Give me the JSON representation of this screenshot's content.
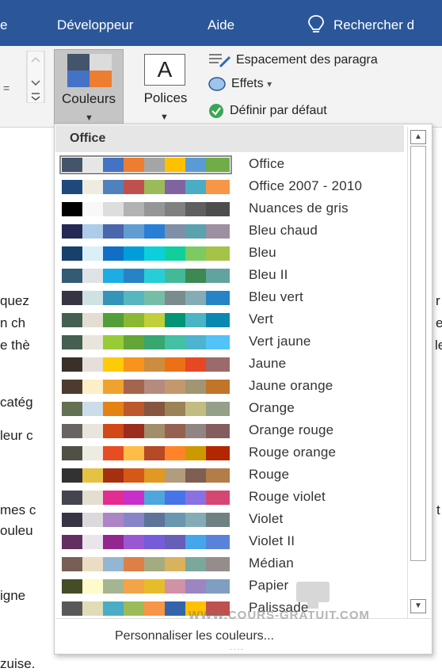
{
  "tabs": {
    "partial_left": "e",
    "developer": "Développeur",
    "help": "Aide",
    "tell_me": "Rechercher d"
  },
  "ribbon": {
    "colors_label": "Couleurs",
    "fonts_label": "Polices",
    "fonts_glyph": "A",
    "paragraph_spacing": "Espacement des paragra",
    "effects": "Effets",
    "effects_arrow": "▾",
    "set_default": "Définir par défaut",
    "spin_partial": "="
  },
  "document_fragments": [
    {
      "id": "f1",
      "text": "quez"
    },
    {
      "id": "f2",
      "text": "n ch"
    },
    {
      "id": "f3",
      "text": "e thè"
    },
    {
      "id": "f4",
      "text": "catég"
    },
    {
      "id": "f5",
      "text": "leur c"
    },
    {
      "id": "f6",
      "text": "mes c"
    },
    {
      "id": "f7",
      "text": "ouleu"
    },
    {
      "id": "f8",
      "text": "igne"
    },
    {
      "id": "f9",
      "text": "zuise."
    },
    {
      "id": "r1",
      "text": "r"
    },
    {
      "id": "r2",
      "text": "e"
    },
    {
      "id": "r3",
      "text": "le"
    },
    {
      "id": "r4",
      "text": "t"
    }
  ],
  "panel": {
    "header": "Office",
    "customize_label": "Personnaliser les couleurs...",
    "grip": "....",
    "watermark": "WWW.COURS-GRATUIT.COM"
  },
  "themes": [
    {
      "name": "Office",
      "selected": true,
      "colors": [
        "#44546a",
        "#e7e6e6",
        "#4472c4",
        "#ed7d31",
        "#a5a5a5",
        "#ffc000",
        "#5b9bd5",
        "#70ad47"
      ]
    },
    {
      "name": "Office 2007 - 2010",
      "colors": [
        "#1f497d",
        "#eeece1",
        "#4f81bd",
        "#c0504d",
        "#9bbb59",
        "#8064a2",
        "#4bacc6",
        "#f79646"
      ]
    },
    {
      "name": "Nuances de gris",
      "colors": [
        "#000000",
        "#f8f8f8",
        "#dddddd",
        "#b2b2b2",
        "#969696",
        "#808080",
        "#5f5f5f",
        "#4d4d4d"
      ]
    },
    {
      "name": "Bleu chaud",
      "colors": [
        "#242852",
        "#acccea",
        "#4a66ac",
        "#629dd1",
        "#297fd5",
        "#7f8fa9",
        "#5aa2ae",
        "#9d90a0"
      ]
    },
    {
      "name": "Bleu",
      "colors": [
        "#17406d",
        "#dbeff9",
        "#0f6fc6",
        "#009dd9",
        "#0bd0d9",
        "#10cf9b",
        "#7cca62",
        "#a5c249"
      ]
    },
    {
      "name": "Bleu II",
      "colors": [
        "#335b74",
        "#dfe3e5",
        "#1cade4",
        "#2683c6",
        "#27ced7",
        "#42ba97",
        "#3e8853",
        "#62a39f"
      ]
    },
    {
      "name": "Bleu vert",
      "colors": [
        "#373545",
        "#cee2e2",
        "#3494ba",
        "#58b6c0",
        "#75bda7",
        "#7a8c8e",
        "#84acb6",
        "#2683c6"
      ]
    },
    {
      "name": "Vert",
      "colors": [
        "#455f51",
        "#e3ded1",
        "#549e39",
        "#8ab833",
        "#c0cf3a",
        "#029676",
        "#4ab5c4",
        "#0989b1"
      ]
    },
    {
      "name": "Vert jaune",
      "colors": [
        "#455f51",
        "#e9e5dc",
        "#99cb38",
        "#63a537",
        "#37a76f",
        "#44c1a3",
        "#4eb3cf",
        "#51c3f9"
      ]
    },
    {
      "name": "Jaune",
      "colors": [
        "#39302a",
        "#e5dedb",
        "#ffca08",
        "#f8931d",
        "#ce8d3e",
        "#ec7016",
        "#e64823",
        "#9c6a6a"
      ]
    },
    {
      "name": "Jaune orange",
      "colors": [
        "#4e3b30",
        "#fbeec9",
        "#f0a22e",
        "#a5644e",
        "#b58b80",
        "#c3986d",
        "#a19574",
        "#c17529"
      ]
    },
    {
      "name": "Orange",
      "colors": [
        "#637052",
        "#ccddea",
        "#e48312",
        "#bd582c",
        "#865640",
        "#9b8357",
        "#c2bc80",
        "#94a088"
      ]
    },
    {
      "name": "Orange rouge",
      "colors": [
        "#696464",
        "#e9e5dc",
        "#d34817",
        "#9b2d1f",
        "#a28e6a",
        "#956251",
        "#918485",
        "#855d5d"
      ]
    },
    {
      "name": "Rouge orange",
      "colors": [
        "#505046",
        "#eeece1",
        "#e84c22",
        "#ffbd47",
        "#b64926",
        "#ff8427",
        "#cc9900",
        "#b22600"
      ]
    },
    {
      "name": "Rouge",
      "colors": [
        "#323232",
        "#e5c243",
        "#a5300f",
        "#d55816",
        "#e19825",
        "#b19c7d",
        "#7f5f52",
        "#b27d49"
      ]
    },
    {
      "name": "Rouge violet",
      "colors": [
        "#454551",
        "#e3ded1",
        "#e32d91",
        "#c830cc",
        "#4ea6dc",
        "#4775e7",
        "#8971e1",
        "#d54773"
      ]
    },
    {
      "name": "Violet",
      "colors": [
        "#373545",
        "#dcd8dc",
        "#ad84c6",
        "#8784c7",
        "#5d739a",
        "#6997af",
        "#84acb6",
        "#6f8183"
      ]
    },
    {
      "name": "Violet II",
      "colors": [
        "#632e62",
        "#eae5eb",
        "#92278f",
        "#9b57d3",
        "#755dd9",
        "#665eb8",
        "#45a5ed",
        "#5982db"
      ]
    },
    {
      "name": "Médian",
      "colors": [
        "#775f55",
        "#ebddc3",
        "#94b6d2",
        "#dd8047",
        "#a5ab81",
        "#d8b25c",
        "#7ba79d",
        "#968c8c"
      ]
    },
    {
      "name": "Papier",
      "colors": [
        "#444d26",
        "#fefac9",
        "#a5b592",
        "#f3a447",
        "#e7bc29",
        "#d092a7",
        "#9c85c0",
        "#809ec2"
      ]
    },
    {
      "name": "Palissade",
      "colors": [
        "#595959",
        "#dfdcb7",
        "#4bacc6",
        "#9bbb59",
        "#f79646",
        "#3464ab",
        "#ffc000",
        "#c0504d"
      ]
    }
  ]
}
